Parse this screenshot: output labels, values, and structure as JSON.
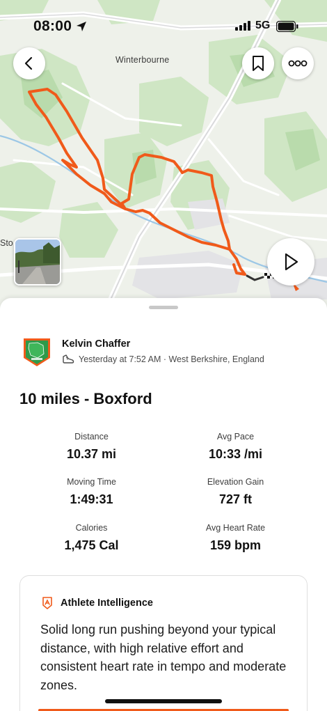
{
  "status_bar": {
    "time": "08:00",
    "network": "5G",
    "icons": [
      "location-arrow-icon",
      "signal-bars-icon",
      "battery-icon"
    ]
  },
  "map": {
    "place_label": "Winterbourne",
    "place_label_partial": "Sto",
    "route_color": "#f05a1a",
    "buttons": [
      "back-icon",
      "bookmark-icon",
      "more-icon",
      "play-icon"
    ]
  },
  "athlete": {
    "name": "Kelvin Chaffer",
    "meta": "Yesterday at 7:52 AM · West Berkshire, England",
    "activity_icon": "shoe-icon"
  },
  "activity": {
    "title": "10 miles - Boxford"
  },
  "stats": [
    {
      "label": "Distance",
      "value": "10.37 mi"
    },
    {
      "label": "Avg Pace",
      "value": "10:33 /mi"
    },
    {
      "label": "Moving Time",
      "value": "1:49:31"
    },
    {
      "label": "Elevation Gain",
      "value": "727 ft"
    },
    {
      "label": "Calories",
      "value": "1,475 Cal"
    },
    {
      "label": "Avg Heart Rate",
      "value": "159 bpm"
    }
  ],
  "athlete_intelligence": {
    "title": "Athlete Intelligence",
    "body": "Solid long run pushing beyond your typical distance, with high relative effort and consistent heart rate in tempo and moderate zones.",
    "accent": "#f05a1a"
  }
}
